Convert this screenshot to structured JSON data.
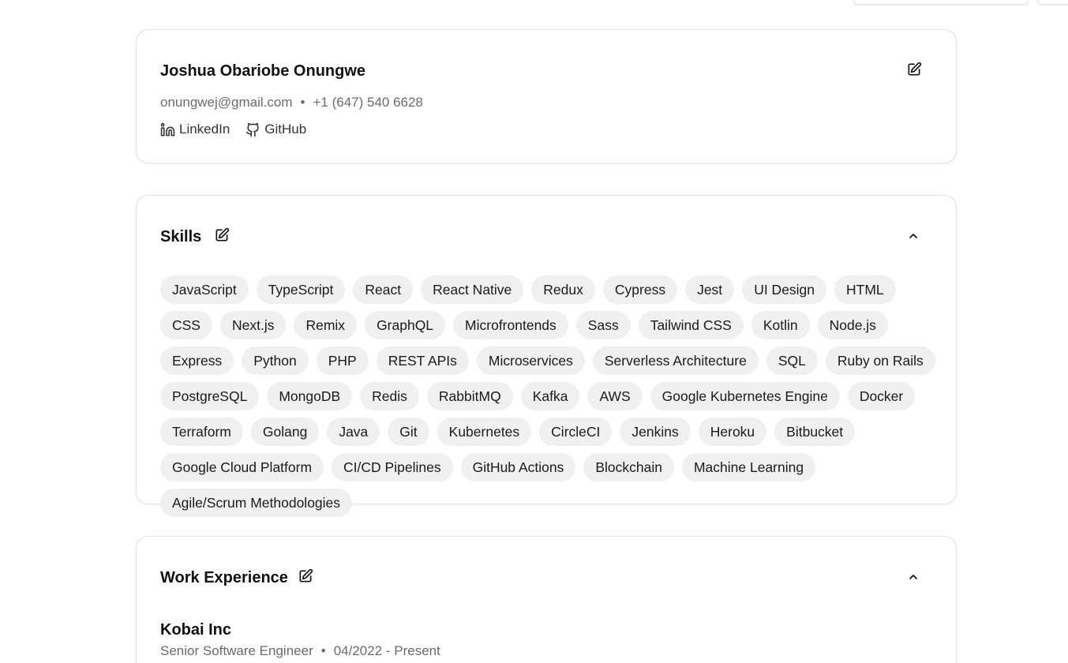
{
  "profile": {
    "name": "Joshua Obariobe Onungwe",
    "email": "onungwej@gmail.com",
    "separator": "•",
    "phone": "+1 (647) 540 6628",
    "links": [
      {
        "label": "LinkedIn",
        "icon": "linkedin-icon"
      },
      {
        "label": "GitHub",
        "icon": "github-icon"
      }
    ]
  },
  "skills": {
    "title": "Skills",
    "items": [
      "JavaScript",
      "TypeScript",
      "React",
      "React Native",
      "Redux",
      "Cypress",
      "Jest",
      "UI Design",
      "HTML",
      "CSS",
      "Next.js",
      "Remix",
      "GraphQL",
      "Microfrontends",
      "Sass",
      "Tailwind CSS",
      "Kotlin",
      "Node.js",
      "Express",
      "Python",
      "PHP",
      "REST APIs",
      "Microservices",
      "Serverless Architecture",
      "SQL",
      "Ruby on Rails",
      "PostgreSQL",
      "MongoDB",
      "Redis",
      "RabbitMQ",
      "Kafka",
      "AWS",
      "Google Kubernetes Engine",
      "Docker",
      "Terraform",
      "Golang",
      "Java",
      "Git",
      "Kubernetes",
      "CircleCI",
      "Jenkins",
      "Heroku",
      "Bitbucket",
      "Google Cloud Platform",
      "CI/CD Pipelines",
      "GitHub Actions",
      "Blockchain",
      "Machine Learning",
      "Agile/Scrum Methodologies"
    ]
  },
  "work": {
    "title": "Work Experience",
    "company": "Kobai Inc",
    "role": "Senior Software Engineer",
    "separator": "•",
    "dates": "04/2022 - Present"
  },
  "colors": {
    "chip_bg": "#f0f0f0",
    "muted_text": "#6b6b6b",
    "border": "#e3e3e3"
  }
}
